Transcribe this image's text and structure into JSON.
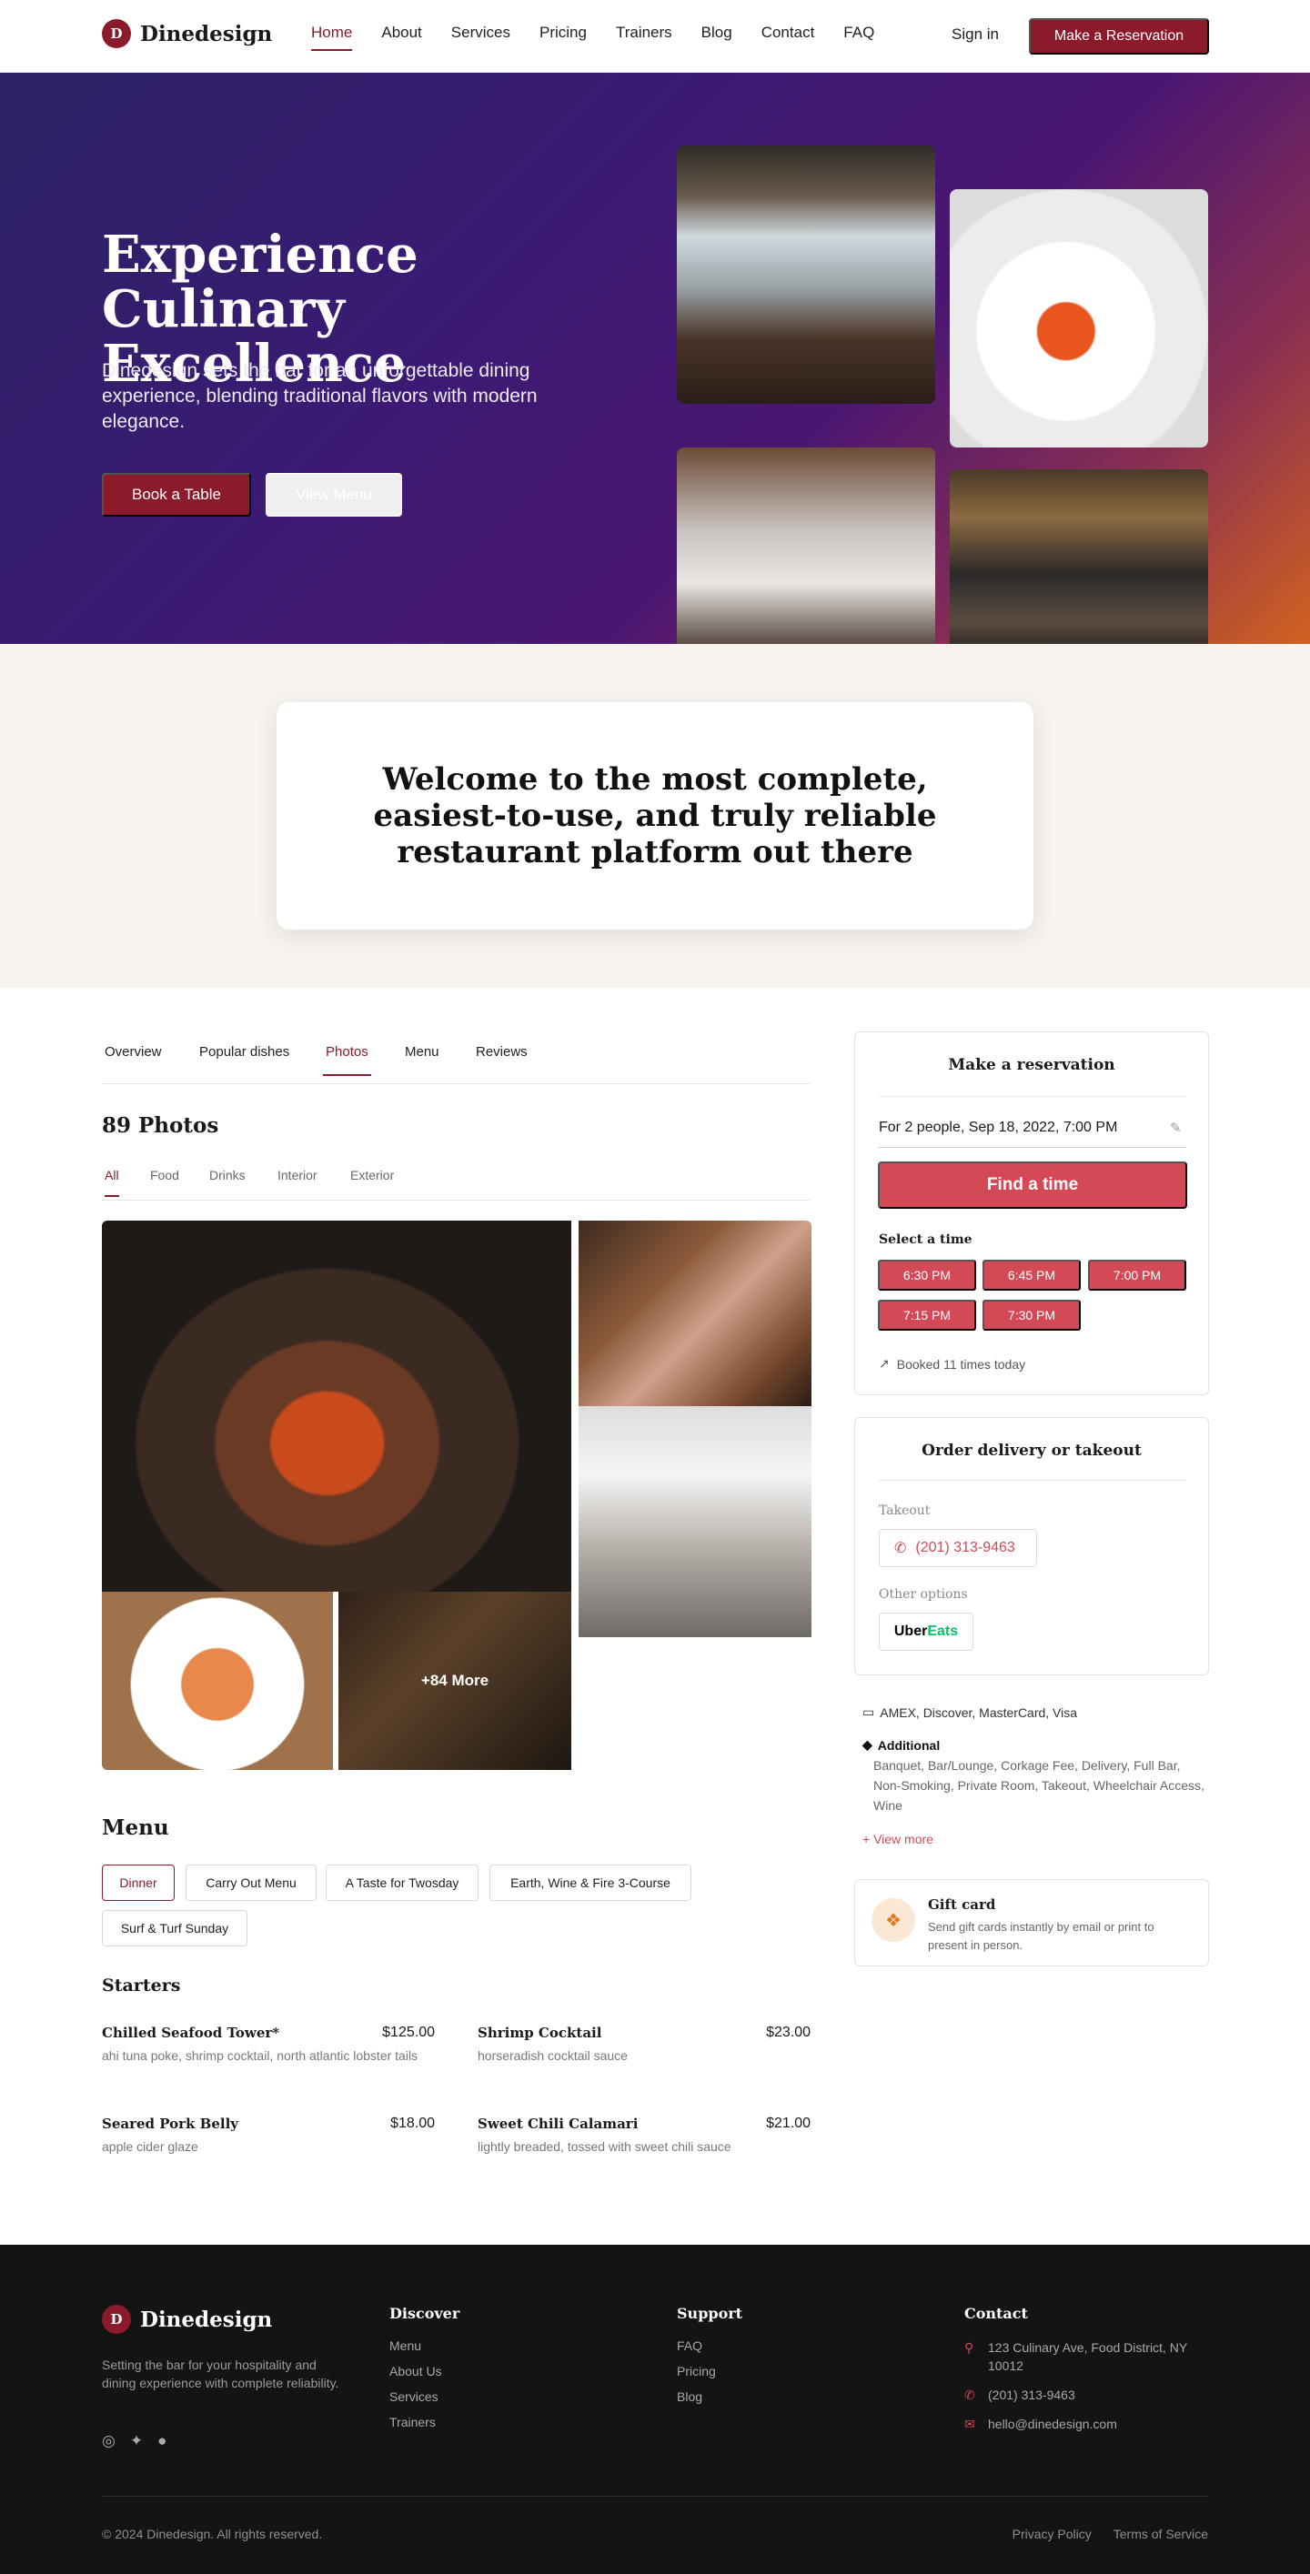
{
  "brand": {
    "initial": "D",
    "name": "Dinedesign",
    "accent": "#8b1a2b",
    "slot_color": "#d34955"
  },
  "nav": {
    "links": [
      "Home",
      "About",
      "Services",
      "Pricing",
      "Trainers",
      "Blog",
      "Contact",
      "FAQ"
    ],
    "active": "Home",
    "signin": "Sign in",
    "cta": "Make a Reservation"
  },
  "hero": {
    "title": "Experience Culinary Excellence",
    "subtitle": "Dinedesign sets the bar for an unforgettable dining experience, blending traditional flavors with modern elegance.",
    "primary_btn": "Book a Table",
    "secondary_btn": "View Menu"
  },
  "welcome": {
    "heading": "Welcome to the most complete, easiest-to-use, and truly reliable restaurant platform out there"
  },
  "tabs": {
    "items": [
      "Overview",
      "Popular dishes",
      "Photos",
      "Menu",
      "Reviews"
    ],
    "active": "Photos"
  },
  "photos": {
    "title": "89 Photos",
    "filters": [
      "All",
      "Food",
      "Drinks",
      "Interior",
      "Exterior"
    ],
    "active_filter": "All",
    "more_label": "+84 More"
  },
  "menu": {
    "title": "Menu",
    "categories": [
      "Dinner",
      "Carry Out Menu",
      "A Taste for Twosday",
      "Earth, Wine & Fire 3-Course",
      "Surf & Turf Sunday"
    ],
    "active_category": "Dinner",
    "section": "Starters",
    "items": [
      {
        "name": "Chilled Seafood Tower*",
        "price": "$125.00",
        "desc": "ahi tuna poke, shrimp cocktail, north atlantic lobster tails"
      },
      {
        "name": "Shrimp Cocktail",
        "price": "$23.00",
        "desc": "horseradish cocktail sauce"
      },
      {
        "name": "Seared Pork Belly",
        "price": "$18.00",
        "desc": "apple cider glaze"
      },
      {
        "name": "Sweet Chili Calamari",
        "price": "$21.00",
        "desc": "lightly breaded, tossed with sweet chili sauce"
      }
    ]
  },
  "reservation": {
    "title": "Make a reservation",
    "party": "For 2 people, Sep 18, 2022, 7:00 PM",
    "find_btn": "Find a time",
    "select_label": "Select a time",
    "slots": [
      "6:30 PM",
      "6:45 PM",
      "7:00 PM",
      "7:15 PM",
      "7:30 PM"
    ],
    "booked": "Booked 11 times today"
  },
  "delivery": {
    "title": "Order delivery or takeout",
    "takeout_label": "Takeout",
    "phone": "(201) 313-9463",
    "other_label": "Other options",
    "uber_a": "Uber",
    "uber_b": "Eats"
  },
  "info": {
    "payment": "AMEX, Discover, MasterCard, Visa",
    "additional_label": "Additional",
    "additional": "Banquet, Bar/Lounge, Corkage Fee, Delivery, Full Bar, Non-Smoking, Private Room, Takeout, Wheelchair Access, Wine",
    "view_more": "+ View more"
  },
  "gift": {
    "title": "Gift card",
    "desc": "Send gift cards instantly by email or print to present in person."
  },
  "footer": {
    "tagline": "Setting the bar for your hospitality and dining experience with complete reliability.",
    "discover": {
      "title": "Discover",
      "links": [
        "Menu",
        "About Us",
        "Services",
        "Trainers"
      ]
    },
    "support": {
      "title": "Support",
      "links": [
        "FAQ",
        "Pricing",
        "Blog"
      ]
    },
    "contact": {
      "title": "Contact",
      "address": "123 Culinary Ave, Food District, NY 10012",
      "phone": "(201) 313-9463",
      "email": "hello@dinedesign.com"
    },
    "copyright": "© 2024 Dinedesign. All rights reserved.",
    "privacy": "Privacy Policy",
    "terms": "Terms of Service"
  }
}
